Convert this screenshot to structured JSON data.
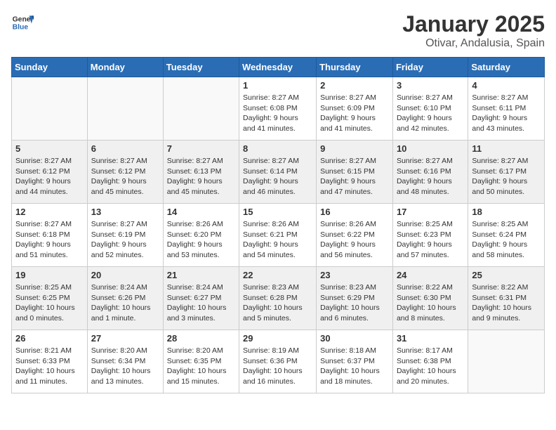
{
  "header": {
    "logo_general": "General",
    "logo_blue": "Blue",
    "title": "January 2025",
    "subtitle": "Otivar, Andalusia, Spain"
  },
  "weekdays": [
    "Sunday",
    "Monday",
    "Tuesday",
    "Wednesday",
    "Thursday",
    "Friday",
    "Saturday"
  ],
  "weeks": [
    [
      {
        "day": "",
        "info": ""
      },
      {
        "day": "",
        "info": ""
      },
      {
        "day": "",
        "info": ""
      },
      {
        "day": "1",
        "info": "Sunrise: 8:27 AM\nSunset: 6:08 PM\nDaylight: 9 hours\nand 41 minutes."
      },
      {
        "day": "2",
        "info": "Sunrise: 8:27 AM\nSunset: 6:09 PM\nDaylight: 9 hours\nand 41 minutes."
      },
      {
        "day": "3",
        "info": "Sunrise: 8:27 AM\nSunset: 6:10 PM\nDaylight: 9 hours\nand 42 minutes."
      },
      {
        "day": "4",
        "info": "Sunrise: 8:27 AM\nSunset: 6:11 PM\nDaylight: 9 hours\nand 43 minutes."
      }
    ],
    [
      {
        "day": "5",
        "info": "Sunrise: 8:27 AM\nSunset: 6:12 PM\nDaylight: 9 hours\nand 44 minutes."
      },
      {
        "day": "6",
        "info": "Sunrise: 8:27 AM\nSunset: 6:12 PM\nDaylight: 9 hours\nand 45 minutes."
      },
      {
        "day": "7",
        "info": "Sunrise: 8:27 AM\nSunset: 6:13 PM\nDaylight: 9 hours\nand 45 minutes."
      },
      {
        "day": "8",
        "info": "Sunrise: 8:27 AM\nSunset: 6:14 PM\nDaylight: 9 hours\nand 46 minutes."
      },
      {
        "day": "9",
        "info": "Sunrise: 8:27 AM\nSunset: 6:15 PM\nDaylight: 9 hours\nand 47 minutes."
      },
      {
        "day": "10",
        "info": "Sunrise: 8:27 AM\nSunset: 6:16 PM\nDaylight: 9 hours\nand 48 minutes."
      },
      {
        "day": "11",
        "info": "Sunrise: 8:27 AM\nSunset: 6:17 PM\nDaylight: 9 hours\nand 50 minutes."
      }
    ],
    [
      {
        "day": "12",
        "info": "Sunrise: 8:27 AM\nSunset: 6:18 PM\nDaylight: 9 hours\nand 51 minutes."
      },
      {
        "day": "13",
        "info": "Sunrise: 8:27 AM\nSunset: 6:19 PM\nDaylight: 9 hours\nand 52 minutes."
      },
      {
        "day": "14",
        "info": "Sunrise: 8:26 AM\nSunset: 6:20 PM\nDaylight: 9 hours\nand 53 minutes."
      },
      {
        "day": "15",
        "info": "Sunrise: 8:26 AM\nSunset: 6:21 PM\nDaylight: 9 hours\nand 54 minutes."
      },
      {
        "day": "16",
        "info": "Sunrise: 8:26 AM\nSunset: 6:22 PM\nDaylight: 9 hours\nand 56 minutes."
      },
      {
        "day": "17",
        "info": "Sunrise: 8:25 AM\nSunset: 6:23 PM\nDaylight: 9 hours\nand 57 minutes."
      },
      {
        "day": "18",
        "info": "Sunrise: 8:25 AM\nSunset: 6:24 PM\nDaylight: 9 hours\nand 58 minutes."
      }
    ],
    [
      {
        "day": "19",
        "info": "Sunrise: 8:25 AM\nSunset: 6:25 PM\nDaylight: 10 hours\nand 0 minutes."
      },
      {
        "day": "20",
        "info": "Sunrise: 8:24 AM\nSunset: 6:26 PM\nDaylight: 10 hours\nand 1 minute."
      },
      {
        "day": "21",
        "info": "Sunrise: 8:24 AM\nSunset: 6:27 PM\nDaylight: 10 hours\nand 3 minutes."
      },
      {
        "day": "22",
        "info": "Sunrise: 8:23 AM\nSunset: 6:28 PM\nDaylight: 10 hours\nand 5 minutes."
      },
      {
        "day": "23",
        "info": "Sunrise: 8:23 AM\nSunset: 6:29 PM\nDaylight: 10 hours\nand 6 minutes."
      },
      {
        "day": "24",
        "info": "Sunrise: 8:22 AM\nSunset: 6:30 PM\nDaylight: 10 hours\nand 8 minutes."
      },
      {
        "day": "25",
        "info": "Sunrise: 8:22 AM\nSunset: 6:31 PM\nDaylight: 10 hours\nand 9 minutes."
      }
    ],
    [
      {
        "day": "26",
        "info": "Sunrise: 8:21 AM\nSunset: 6:33 PM\nDaylight: 10 hours\nand 11 minutes."
      },
      {
        "day": "27",
        "info": "Sunrise: 8:20 AM\nSunset: 6:34 PM\nDaylight: 10 hours\nand 13 minutes."
      },
      {
        "day": "28",
        "info": "Sunrise: 8:20 AM\nSunset: 6:35 PM\nDaylight: 10 hours\nand 15 minutes."
      },
      {
        "day": "29",
        "info": "Sunrise: 8:19 AM\nSunset: 6:36 PM\nDaylight: 10 hours\nand 16 minutes."
      },
      {
        "day": "30",
        "info": "Sunrise: 8:18 AM\nSunset: 6:37 PM\nDaylight: 10 hours\nand 18 minutes."
      },
      {
        "day": "31",
        "info": "Sunrise: 8:17 AM\nSunset: 6:38 PM\nDaylight: 10 hours\nand 20 minutes."
      },
      {
        "day": "",
        "info": ""
      }
    ]
  ]
}
